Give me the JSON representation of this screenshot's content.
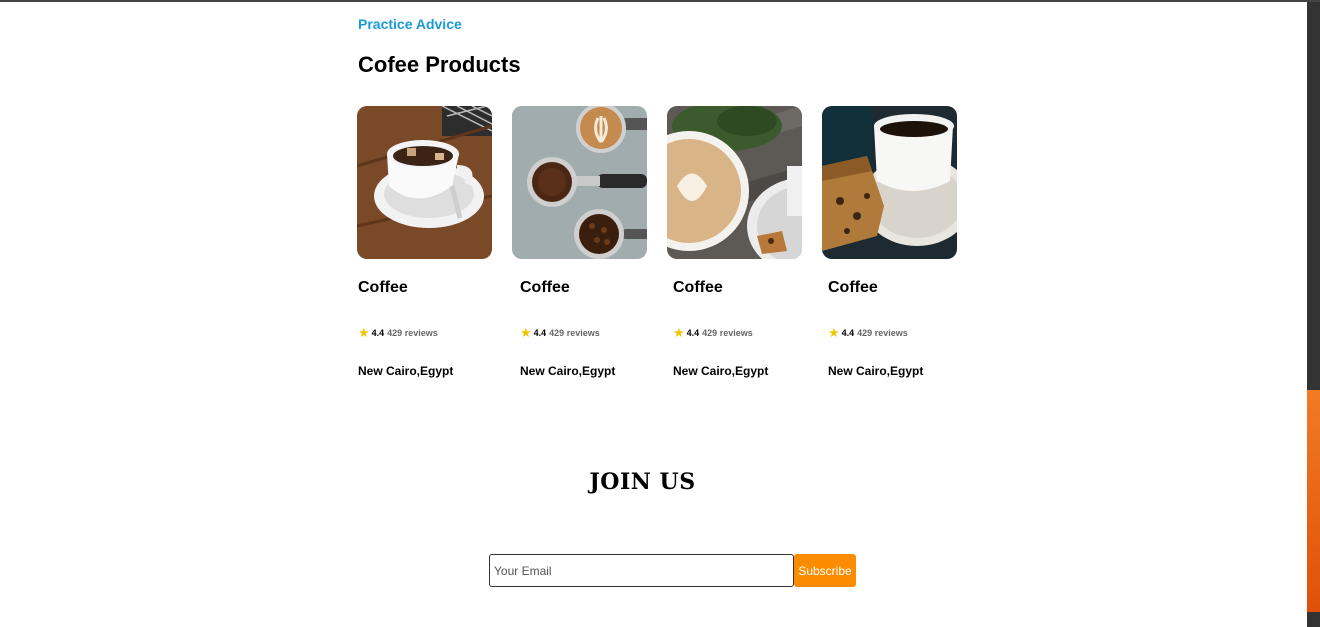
{
  "section": {
    "eyebrow": "Practice Advice",
    "title": "Cofee Products"
  },
  "products": [
    {
      "title": "Coffee",
      "rating": "4.4",
      "reviews": "429 reviews",
      "location": "New Cairo,Egypt",
      "icon": "star-icon"
    },
    {
      "title": "Coffee",
      "rating": "4.4",
      "reviews": "429 reviews",
      "location": "New Cairo,Egypt",
      "icon": "star-icon"
    },
    {
      "title": "Coffee",
      "rating": "4.4",
      "reviews": "429 reviews",
      "location": "New Cairo,Egypt",
      "icon": "star-icon"
    },
    {
      "title": "Coffee",
      "rating": "4.4",
      "reviews": "429 reviews",
      "location": "New Cairo,Egypt",
      "icon": "star-icon"
    }
  ],
  "join": {
    "title": "JOIN US",
    "email_placeholder": "Your Email",
    "email_value": "",
    "subscribe_label": "Subscribe"
  },
  "colors": {
    "accent": "#1a9ad6",
    "button": "#fb8c00",
    "star": "#f5c400",
    "scroll_thumb": "#f07b25"
  }
}
